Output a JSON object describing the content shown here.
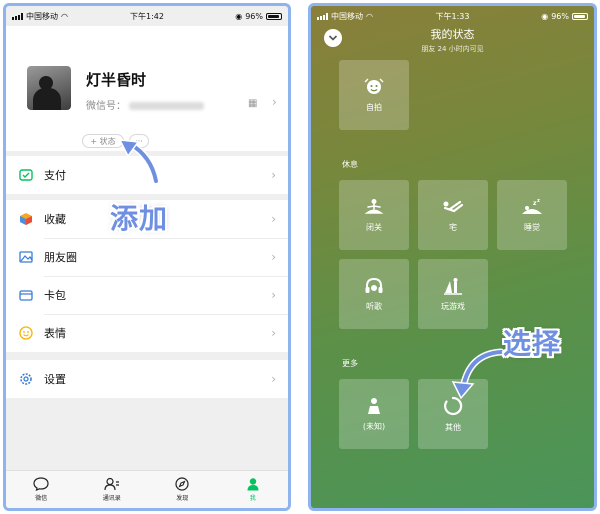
{
  "left": {
    "status": {
      "carrier": "中国移动",
      "time": "下午1:42",
      "battery": "96%"
    },
    "profile": {
      "name": "灯半昏时",
      "wechat_id_label": "微信号：",
      "status_chip": "+ 状态",
      "more_chip": "···"
    },
    "menu_groups": [
      [
        {
          "label": "支付",
          "icon": "pay-icon"
        }
      ],
      [
        {
          "label": "收藏",
          "icon": "favorites-icon"
        },
        {
          "label": "朋友圈",
          "icon": "moments-icon"
        },
        {
          "label": "卡包",
          "icon": "cards-icon"
        },
        {
          "label": "表情",
          "icon": "sticker-icon"
        }
      ],
      [
        {
          "label": "设置",
          "icon": "settings-icon"
        }
      ]
    ],
    "tabs": [
      {
        "label": "微信",
        "icon": "chat-icon"
      },
      {
        "label": "通讯录",
        "icon": "contacts-icon"
      },
      {
        "label": "发现",
        "icon": "discover-icon"
      },
      {
        "label": "我",
        "icon": "me-icon"
      }
    ],
    "annotation": "添加"
  },
  "right": {
    "status": {
      "carrier": "中国移动",
      "time": "下午1:33",
      "battery": "96%"
    },
    "title": "我的状态",
    "subtitle": "朋友 24 小时内可见",
    "top_tiles": [
      {
        "label": "自拍",
        "icon": "selfie-icon"
      }
    ],
    "rest_section": "休息",
    "rest_tiles": [
      {
        "label": "闭关",
        "icon": "meditation-icon"
      },
      {
        "label": "宅",
        "icon": "lounge-icon"
      },
      {
        "label": "睡觉",
        "icon": "sleep-icon"
      },
      {
        "label": "听歌",
        "icon": "headphones-icon"
      },
      {
        "label": "玩游戏",
        "icon": "game-icon"
      }
    ],
    "more_section": "更多",
    "more_tiles": [
      {
        "label": "(未知)",
        "icon": "unknown-person-icon"
      },
      {
        "label": "其他",
        "icon": "other-circle-icon"
      }
    ],
    "annotation": "选择"
  },
  "colors": {
    "accent": "#07c160",
    "annotation": "#6f8fe0",
    "frame": "#8fb3ec"
  }
}
